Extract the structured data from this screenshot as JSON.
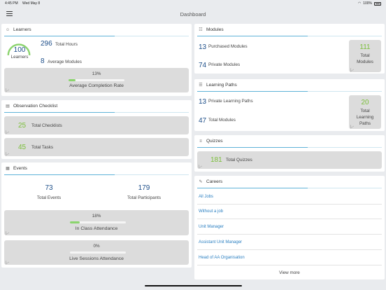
{
  "status": {
    "time": "4:45 PM",
    "date": "Wed May 8",
    "battery": "100%"
  },
  "nav": {
    "title": "Dashboard"
  },
  "learners": {
    "title": "Learners",
    "gauge_value": "100",
    "gauge_label": "Learners",
    "total_hours_value": "296",
    "total_hours_label": "Total Hours",
    "avg_modules_value": "8",
    "avg_modules_label": "Average Modules",
    "completion_value": "13%",
    "completion_fraction": 0.13,
    "completion_label": "Average Completion Rate"
  },
  "observation": {
    "title": "Observation Checklist",
    "checklists_value": "25",
    "checklists_label": "Total Checklists",
    "tasks_value": "45",
    "tasks_label": "Total Tasks"
  },
  "events": {
    "title": "Events",
    "total_events_value": "73",
    "total_events_label": "Total Events",
    "participants_value": "179",
    "participants_label": "Total Participants",
    "in_class_value": "18%",
    "in_class_fraction": 0.18,
    "in_class_label": "In Class Attendance",
    "live_value": "0%",
    "live_fraction": 0,
    "live_label": "Live Sessions Attendance"
  },
  "modules": {
    "title": "Modules",
    "purchased_value": "13",
    "purchased_label": "Purchased Modules",
    "private_value": "74",
    "private_label": "Private Modules",
    "total_value": "111",
    "total_label": "Total Modules"
  },
  "paths": {
    "title": "Learning Paths",
    "private_value": "13",
    "private_label": "Private Learning Paths",
    "modules_value": "47",
    "modules_label": "Total Modules",
    "total_value": "20",
    "total_label": "Total Learning Paths"
  },
  "quizzes": {
    "title": "Quizzes",
    "total_value": "181",
    "total_label": "Total Quizzes"
  },
  "careers": {
    "title": "Careers",
    "items": [
      "All Jobs",
      "Without a job",
      "Unit Manager",
      "Assistant Unit Manager",
      "Head of AA Organisation"
    ],
    "view_more": "View more"
  }
}
